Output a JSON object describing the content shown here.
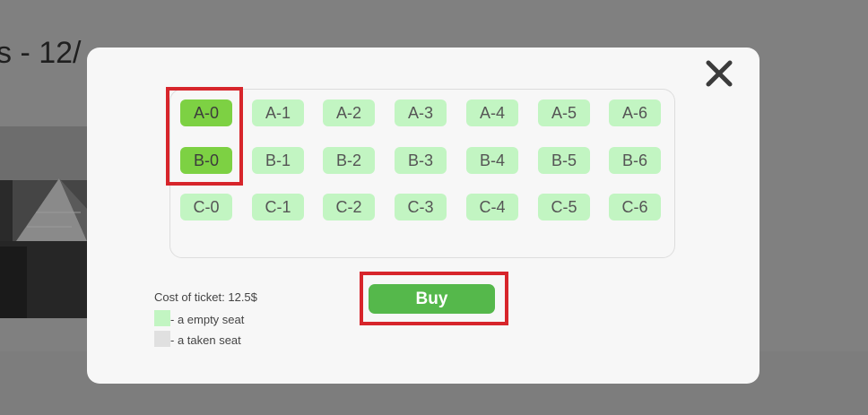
{
  "background": {
    "title_fragment": "s - 12/"
  },
  "modal": {
    "close_label": "✕",
    "seats": [
      {
        "label": "A-0",
        "state": "selected"
      },
      {
        "label": "A-1",
        "state": "empty"
      },
      {
        "label": "A-2",
        "state": "empty"
      },
      {
        "label": "A-3",
        "state": "empty"
      },
      {
        "label": "A-4",
        "state": "empty"
      },
      {
        "label": "A-5",
        "state": "empty"
      },
      {
        "label": "A-6",
        "state": "empty"
      },
      {
        "label": "B-0",
        "state": "selected"
      },
      {
        "label": "B-1",
        "state": "empty"
      },
      {
        "label": "B-2",
        "state": "empty"
      },
      {
        "label": "B-3",
        "state": "empty"
      },
      {
        "label": "B-4",
        "state": "empty"
      },
      {
        "label": "B-5",
        "state": "empty"
      },
      {
        "label": "B-6",
        "state": "empty"
      },
      {
        "label": "C-0",
        "state": "empty"
      },
      {
        "label": "C-1",
        "state": "empty"
      },
      {
        "label": "C-2",
        "state": "empty"
      },
      {
        "label": "C-3",
        "state": "empty"
      },
      {
        "label": "C-4",
        "state": "empty"
      },
      {
        "label": "C-5",
        "state": "empty"
      },
      {
        "label": "C-6",
        "state": "empty"
      }
    ],
    "buy_label": "Buy",
    "cost_text": "Cost of ticket: 12.5$",
    "legend": {
      "empty_text": "- a empty seat",
      "taken_text": "- a taken seat"
    }
  },
  "colors": {
    "empty_seat": "#c2f5c2",
    "selected_seat": "#7dd143",
    "taken_seat": "#e0e0e0",
    "buy_button": "#55b84b",
    "highlight": "#d7252b"
  }
}
